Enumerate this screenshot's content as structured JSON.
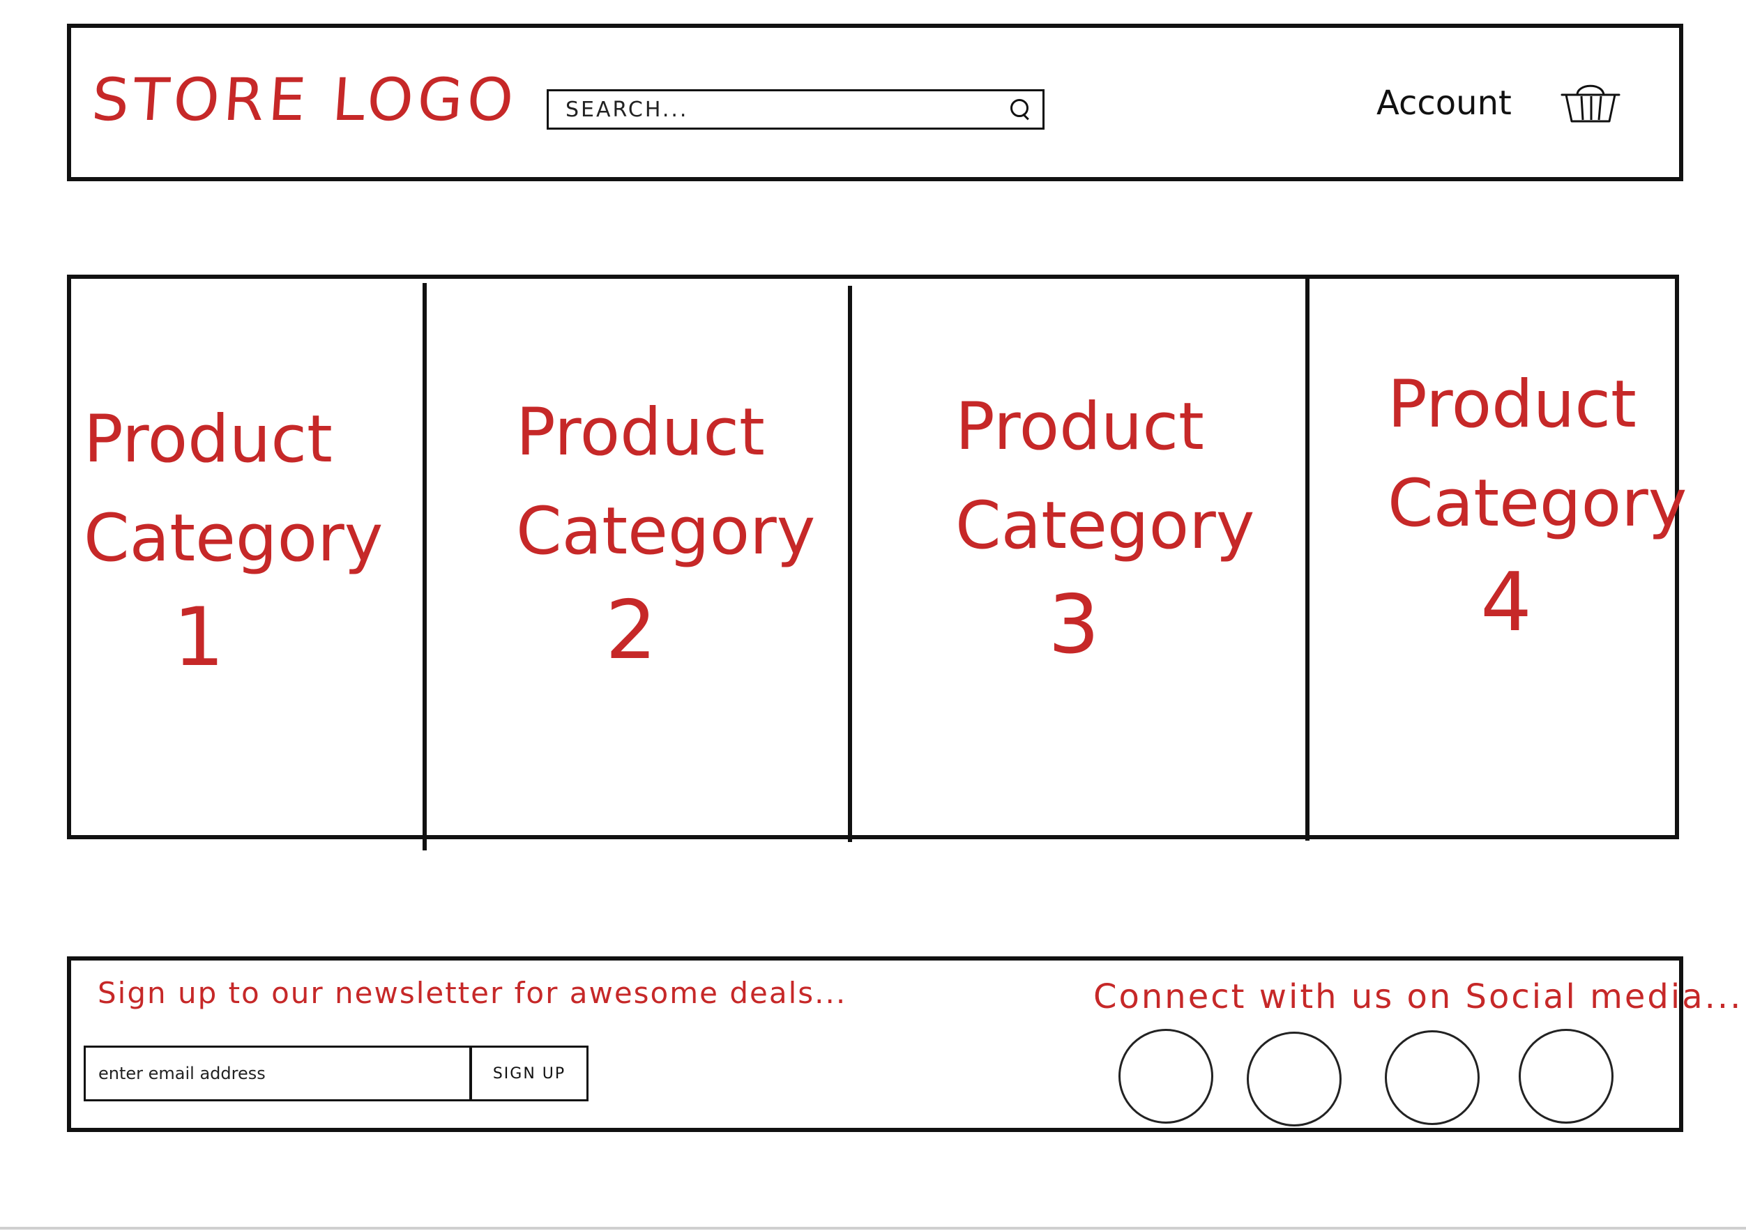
{
  "header": {
    "logo": "STORE LOGO",
    "search_placeholder": "SEARCH...",
    "account_label": "Account"
  },
  "categories": [
    {
      "line1": "Product",
      "line2": "Category",
      "number": "1"
    },
    {
      "line1": "Product",
      "line2": "Category",
      "number": "2"
    },
    {
      "line1": "Product",
      "line2": "Category",
      "number": "3"
    },
    {
      "line1": "Product",
      "line2": "Category",
      "number": "4"
    }
  ],
  "footer": {
    "newsletter_text": "Sign up to our newsletter for awesome deals...",
    "email_placeholder": "enter email address",
    "signup_label": "SIGN UP",
    "social_text": "Connect with us on Social media...",
    "social_links_count": 4
  },
  "colors": {
    "ink": "#111111",
    "accent_red": "#c62828"
  }
}
